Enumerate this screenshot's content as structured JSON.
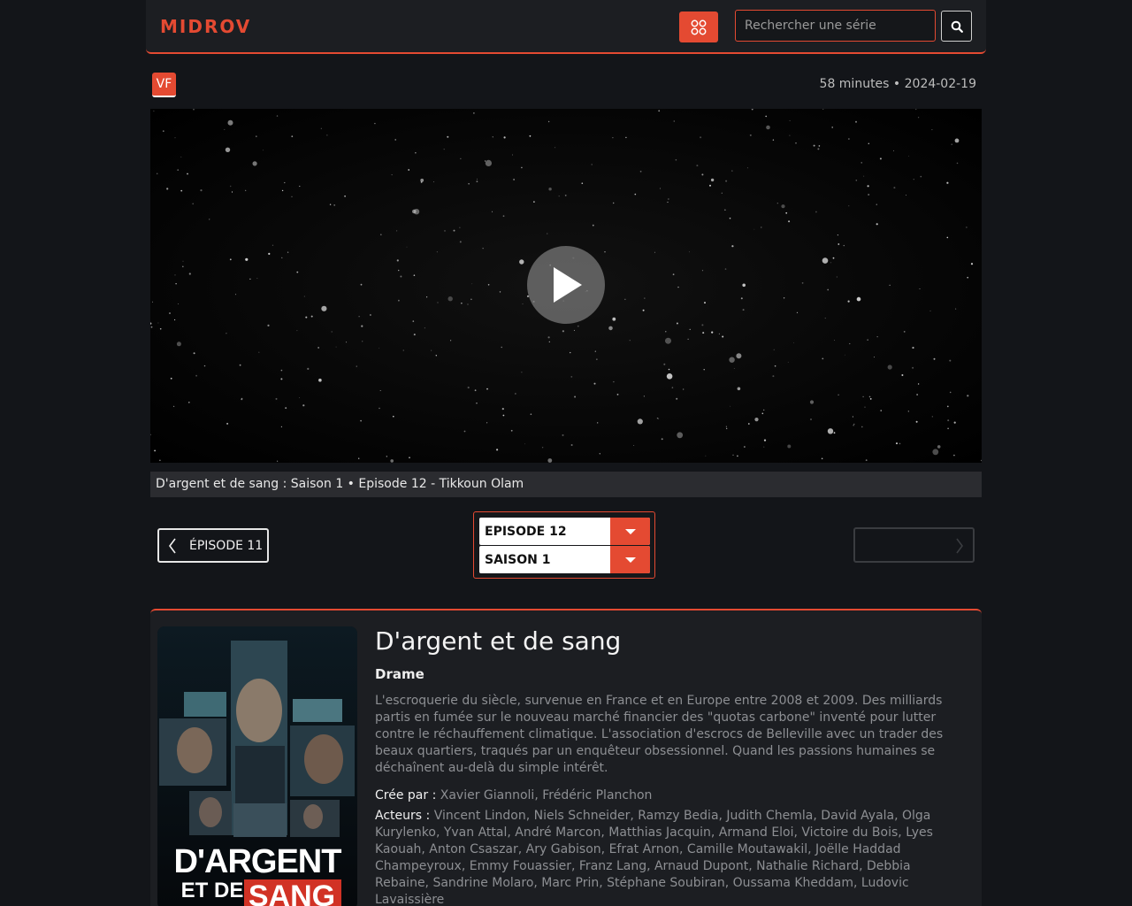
{
  "header": {
    "logo": "MIDROV",
    "search_placeholder": "Rechercher une série"
  },
  "episode_meta": {
    "language_badge": "VF",
    "duration_date": "58 minutes • 2024-02-19"
  },
  "player": {
    "caption": "D'argent et de sang : Saison 1 • Episode 12 - Tikkoun Olam"
  },
  "navigation": {
    "prev_label": "ÉPISODE 11",
    "next_label": "",
    "episode_select": "EPISODE 12",
    "season_select": "SAISON 1"
  },
  "show": {
    "poster_line1": "D'ARGENT",
    "poster_line2": "ET DE",
    "poster_line3": "SANG",
    "title": "D'argent et de sang",
    "genre": "Drame",
    "synopsis": "L'escroquerie du siècle, survenue en France et en Europe entre 2008 et 2009. Des milliards partis en fumée sur le nouveau marché financier des \"quotas carbone\" inventé pour lutter contre le réchauffement climatique. L'association d'escrocs de Belleville avec un trader des beaux quartiers, traqués par un enquêteur obsessionnel. Quand les passions humaines se déchaînent au-delà du simple intérêt.",
    "created_by_label": "Crée par :",
    "created_by": "Xavier Giannoli, Frédéric Planchon",
    "actors_label": "Acteurs :",
    "actors": "Vincent Lindon, Niels Schneider, Ramzy Bedia, Judith Chemla, David Ayala, Olga Kurylenko, Yvan Attal, André Marcon, Matthias Jacquin, Armand Eloi, Victoire du Bois, Lyes Kaouah, Anton Csaszar, Ary Gabison, Efrat Arnon, Camille Moutawakil, Joëlle Haddad Champeyroux, Emmy Fouassier, Franz Lang, Arnaud Dupont, Nathalie Richard, Debbia Rebaine, Sandrine Molaro, Marc Prin, Stéphane Soubiran, Oussama Kheddam, Ludovic Lavaissière"
  },
  "colors": {
    "accent": "#e44a32",
    "background": "#131519",
    "panel": "#1c1e22"
  }
}
